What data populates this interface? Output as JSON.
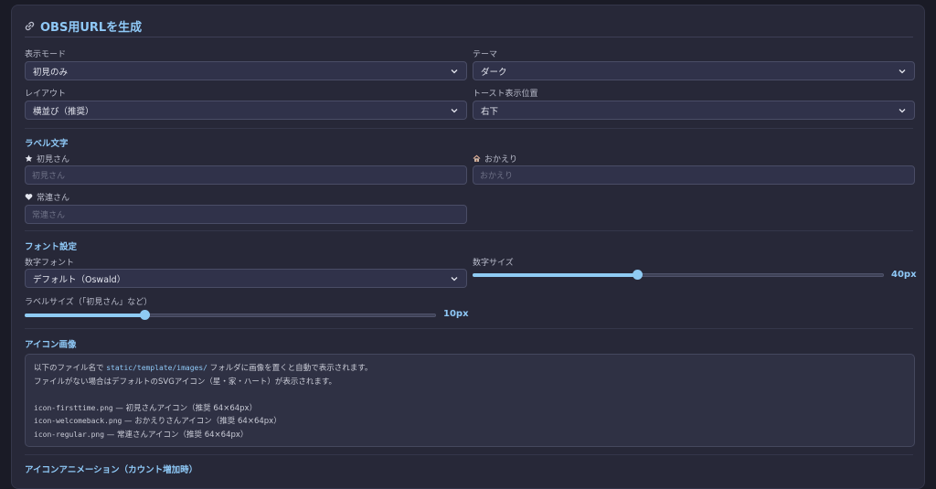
{
  "header": {
    "title": "OBS用URLを生成",
    "icon": "link-icon"
  },
  "display_mode": {
    "label": "表示モード",
    "value": "初見のみ"
  },
  "theme": {
    "label": "テーマ",
    "value": "ダーク"
  },
  "layout": {
    "label": "レイアウト",
    "value": "横並び（推奨）"
  },
  "toast_position": {
    "label": "トースト表示位置",
    "value": "右下"
  },
  "labels_section": {
    "title": "ラベル文字",
    "firsttime": {
      "label": "初見さん",
      "icon": "star-icon",
      "placeholder": "初見さん"
    },
    "welcomeback": {
      "label": "おかえり",
      "icon": "house-icon",
      "placeholder": "おかえり"
    },
    "regular": {
      "label": "常連さん",
      "icon": "heart-icon",
      "placeholder": "常連さん"
    }
  },
  "font_section": {
    "title": "フォント設定",
    "number_font": {
      "label": "数字フォント",
      "value": "デフォルト（Oswald）"
    },
    "number_size": {
      "label": "数字サイズ",
      "value": "40px",
      "level": 0.4
    },
    "label_size": {
      "label": "ラベルサイズ（「初見さん」など）",
      "value": "10px",
      "level": 0.29
    }
  },
  "icon_section": {
    "title": "アイコン画像",
    "line1_prefix": "以下のファイル名で ",
    "line1_path": "static/template/images/",
    "line1_suffix": " フォルダに画像を置くと自動で表示されます。",
    "line2": "ファイルがない場合はデフォルトのSVGアイコン（星・家・ハート）が表示されます。",
    "files": [
      {
        "name": "icon-firsttime.png",
        "desc": " — 初見さんアイコン（推奨 64×64px）"
      },
      {
        "name": "icon-welcomeback.png",
        "desc": " — おかえりさんアイコン（推奨 64×64px）"
      },
      {
        "name": "icon-regular.png",
        "desc": " — 常連さんアイコン（推奨 64×64px）"
      }
    ]
  },
  "animation_section": {
    "title": "アイコンアニメーション（カウント増加時）"
  },
  "colors": {
    "accent": "#8fc9f7",
    "panel": "#272838",
    "field": "#30324a"
  }
}
